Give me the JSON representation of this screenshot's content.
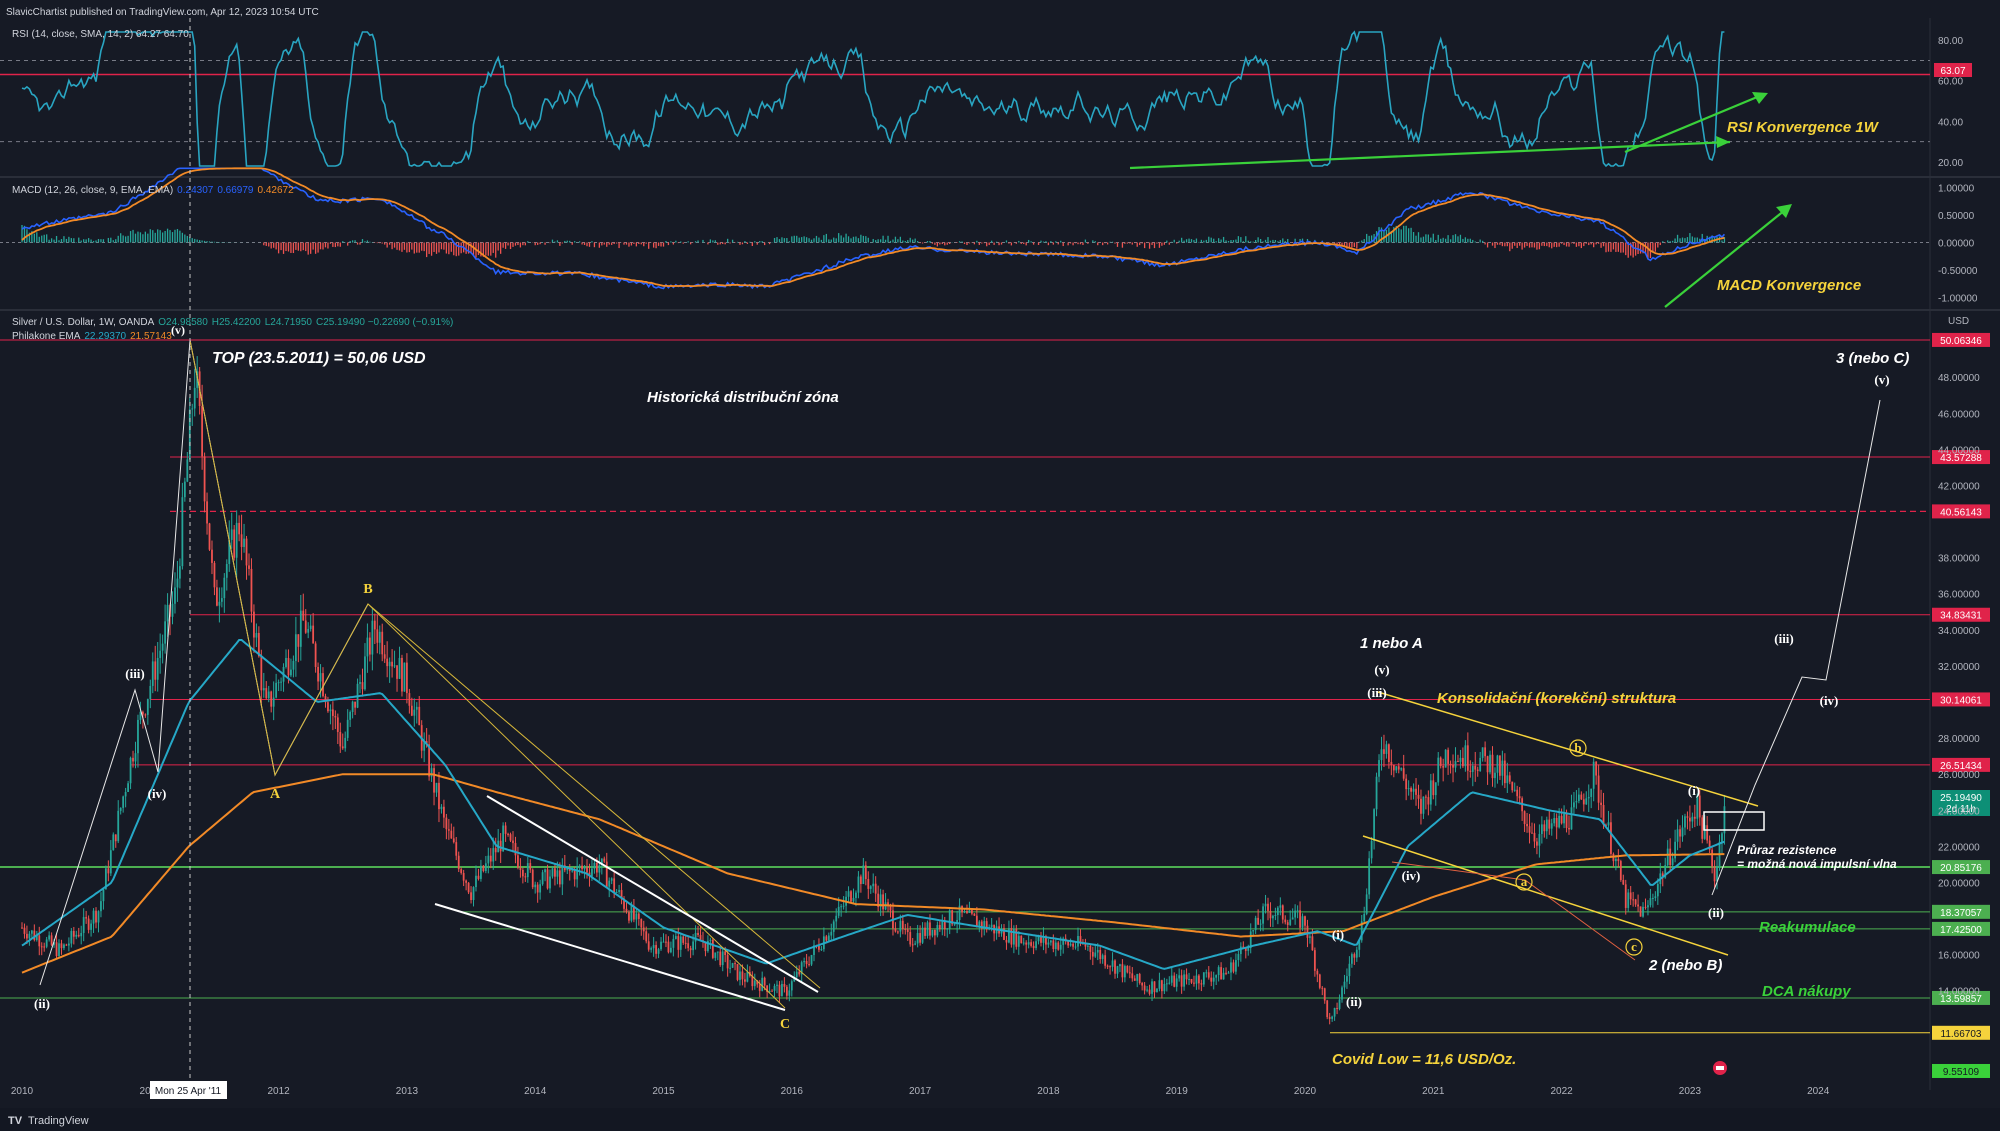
{
  "header": {
    "published": "SlavicChartist published on TradingView.com, Apr 12, 2023 10:54 UTC"
  },
  "footer": {
    "brand": "TradingView"
  },
  "colors": {
    "bg": "#161a25",
    "rsi": "#29a5c2",
    "macd": "#2962ff",
    "signal": "#f28a27",
    "price": "#1e90c8",
    "ema_slow": "#f28a27",
    "green": "#4caf50",
    "red_line": "#e0234a",
    "yellow": "#f5d33c"
  },
  "rsi_panel": {
    "legend": "RSI (14, close, SMA, 14, 2) 64.27 64.70",
    "ticks": [
      "80.00",
      "60.00",
      "40.00",
      "20.00"
    ],
    "current": "63.07",
    "note": "RSI Konvergence 1W"
  },
  "macd_panel": {
    "legend_prefix": "MACD (12, 26, close, 9, EMA, EMA)",
    "v1": "0.24307",
    "v2": "0.66979",
    "v3": "0.42672",
    "ticks": [
      "1.00000",
      "0.50000",
      "0.00000",
      "-0.50000",
      "-1.00000"
    ],
    "note": "MACD Konvergence"
  },
  "price_panel": {
    "legend1_prefix": "Silver / U.S. Dollar, 1W, OANDA",
    "ohlc": {
      "o": "O24.98580",
      "h": "H25.42200",
      "l": "L24.71950",
      "c": "C25.19490 −0.22690 (−0.91%)"
    },
    "legend2_prefix": "Philakone EMA",
    "ema1": "22.29370",
    "ema2": "21.57143",
    "currency": "USD",
    "ticks": [
      "48.00000",
      "46.00000",
      "44.00000",
      "42.00000",
      "38.00000",
      "36.00000",
      "34.00000",
      "32.00000",
      "28.00000",
      "26.00000",
      "24.00000",
      "22.00000",
      "20.00000",
      "16.00000",
      "14.00000"
    ],
    "current_price": "25.19490",
    "countdown": "2d 11h",
    "levels": [
      "50.06346",
      "43.57288",
      "40.56143",
      "34.83431",
      "30.14061",
      "26.51434",
      "20.85176",
      "18.37057",
      "17.42500",
      "13.59857",
      "11.66703",
      "9.55109"
    ]
  },
  "x_axis": {
    "labels": [
      "2010",
      "2011",
      "2012",
      "2013",
      "2014",
      "2015",
      "2016",
      "2017",
      "2018",
      "2019",
      "2020",
      "2021",
      "2022",
      "2023",
      "2024"
    ],
    "crosshair_label": "Mon 25 Apr '11"
  },
  "annotations": {
    "top": "TOP (23.5.2011) = 50,06 USD",
    "distribution": "Historická distribuční zóna",
    "one_or_a": "1 nebo A",
    "consolidation": "Konsolidační (korekční) struktura",
    "breakout1": "Průraz rezistence",
    "breakout2": "= možná nová impulsní vlna",
    "reaccumulation": "Reakumulace",
    "dca": "DCA nákupy",
    "covid": "Covid Low = 11,6 USD/Oz.",
    "two_or_b": "2 (nebo B)",
    "three_or_c": "3 (nebo C)"
  },
  "wave_labels": {
    "i": "(i)",
    "ii": "(ii)",
    "iii": "(iii)",
    "iv": "(iv)",
    "v": "(v)",
    "A": "A",
    "B": "B",
    "C": "C",
    "a": "a",
    "b": "b",
    "c": "c"
  },
  "chart_data": {
    "type": "candlestick",
    "symbol": "Silver / U.S. Dollar, 1W, OANDA",
    "x_range": [
      "2010",
      "2024"
    ],
    "ylim": [
      9,
      51
    ],
    "close_path": [
      [
        "2010.0",
        17.5
      ],
      [
        "2010.3",
        16.2
      ],
      [
        "2010.6",
        18.5
      ],
      [
        "2010.9",
        28.5
      ],
      [
        "2011.2",
        36.0
      ],
      [
        "2011.35",
        48.5
      ],
      [
        "2011.5",
        35.5
      ],
      [
        "2011.7",
        40.0
      ],
      [
        "2011.9",
        29.5
      ],
      [
        "2012.2",
        34.5
      ],
      [
        "2012.5",
        27.5
      ],
      [
        "2012.75",
        34.2
      ],
      [
        "2013.0",
        31.0
      ],
      [
        "2013.3",
        23.0
      ],
      [
        "2013.5",
        19.5
      ],
      [
        "2013.75",
        22.5
      ],
      [
        "2014.0",
        20.0
      ],
      [
        "2014.5",
        21.0
      ],
      [
        "2014.9",
        16.5
      ],
      [
        "2015.3",
        16.8
      ],
      [
        "2015.6",
        14.8
      ],
      [
        "2015.95",
        13.9
      ],
      [
        "2016.3",
        17.5
      ],
      [
        "2016.55",
        20.5
      ],
      [
        "2016.9",
        16.8
      ],
      [
        "2017.3",
        18.2
      ],
      [
        "2017.8",
        16.8
      ],
      [
        "2018.3",
        16.5
      ],
      [
        "2018.75",
        14.2
      ],
      [
        "2019.4",
        15.0
      ],
      [
        "2019.7",
        18.5
      ],
      [
        "2020.0",
        17.8
      ],
      [
        "2020.2",
        12.0
      ],
      [
        "2020.45",
        17.8
      ],
      [
        "2020.6",
        28.0
      ],
      [
        "2020.9",
        24.0
      ],
      [
        "2021.1",
        27.2
      ],
      [
        "2021.5",
        26.5
      ],
      [
        "2021.8",
        22.5
      ],
      [
        "2022.1",
        23.8
      ],
      [
        "2022.25",
        26.0
      ],
      [
        "2022.5",
        19.0
      ],
      [
        "2022.65",
        18.3
      ],
      [
        "2022.9",
        22.5
      ],
      [
        "2023.05",
        24.3
      ],
      [
        "2023.2",
        20.3
      ],
      [
        "2023.28",
        25.19
      ]
    ],
    "ema_slow_path": [
      [
        "2010.0",
        15.0
      ],
      [
        "2010.7",
        17.0
      ],
      [
        "2011.3",
        22.0
      ],
      [
        "2011.8",
        25.0
      ],
      [
        "2012.5",
        26.0
      ],
      [
        "2013.2",
        26.0
      ],
      [
        "2013.7",
        25.0
      ],
      [
        "2014.5",
        23.5
      ],
      [
        "2015.5",
        20.5
      ],
      [
        "2016.5",
        18.8
      ],
      [
        "2017.5",
        18.5
      ],
      [
        "2018.5",
        17.8
      ],
      [
        "2019.5",
        17.0
      ],
      [
        "2020.3",
        17.3
      ],
      [
        "2021.0",
        19.2
      ],
      [
        "2021.8",
        21.0
      ],
      [
        "2022.5",
        21.5
      ],
      [
        "2023.28",
        21.57
      ]
    ],
    "ema_fast_path": [
      [
        "2010.0",
        16.5
      ],
      [
        "2010.7",
        20.0
      ],
      [
        "2011.3",
        30.0
      ],
      [
        "2011.7",
        33.5
      ],
      [
        "2012.3",
        30.0
      ],
      [
        "2012.8",
        30.5
      ],
      [
        "2013.3",
        26.5
      ],
      [
        "2013.7",
        22.0
      ],
      [
        "2014.4",
        20.5
      ],
      [
        "2015.0",
        17.5
      ],
      [
        "2015.8",
        15.5
      ],
      [
        "2016.4",
        17.0
      ],
      [
        "2016.9",
        18.2
      ],
      [
        "2017.5",
        17.5
      ],
      [
        "2018.4",
        16.5
      ],
      [
        "2018.9",
        15.2
      ],
      [
        "2019.6",
        16.5
      ],
      [
        "2020.1",
        17.3
      ],
      [
        "2020.4",
        16.5
      ],
      [
        "2020.8",
        22.0
      ],
      [
        "2021.3",
        25.0
      ],
      [
        "2021.9",
        24.0
      ],
      [
        "2022.3",
        23.5
      ],
      [
        "2022.7",
        19.8
      ],
      [
        "2023.0",
        21.5
      ],
      [
        "2023.28",
        22.29
      ]
    ],
    "projection_path": [
      [
        "2023.18",
        20.3
      ],
      [
        "2023.55",
        33.0
      ],
      [
        "2023.8",
        31.5
      ],
      [
        "2024.08",
        47.0
      ]
    ],
    "horizontal_levels": [
      50.06346,
      43.57288,
      40.56143,
      34.83431,
      30.14061,
      26.51434,
      20.85176,
      18.37057,
      17.425,
      13.59857,
      11.66703
    ],
    "rsi_ylim": [
      15,
      85
    ],
    "rsi_levels": [
      70,
      63.07,
      30
    ],
    "macd_ylim": [
      -1.2,
      1.2
    ]
  }
}
